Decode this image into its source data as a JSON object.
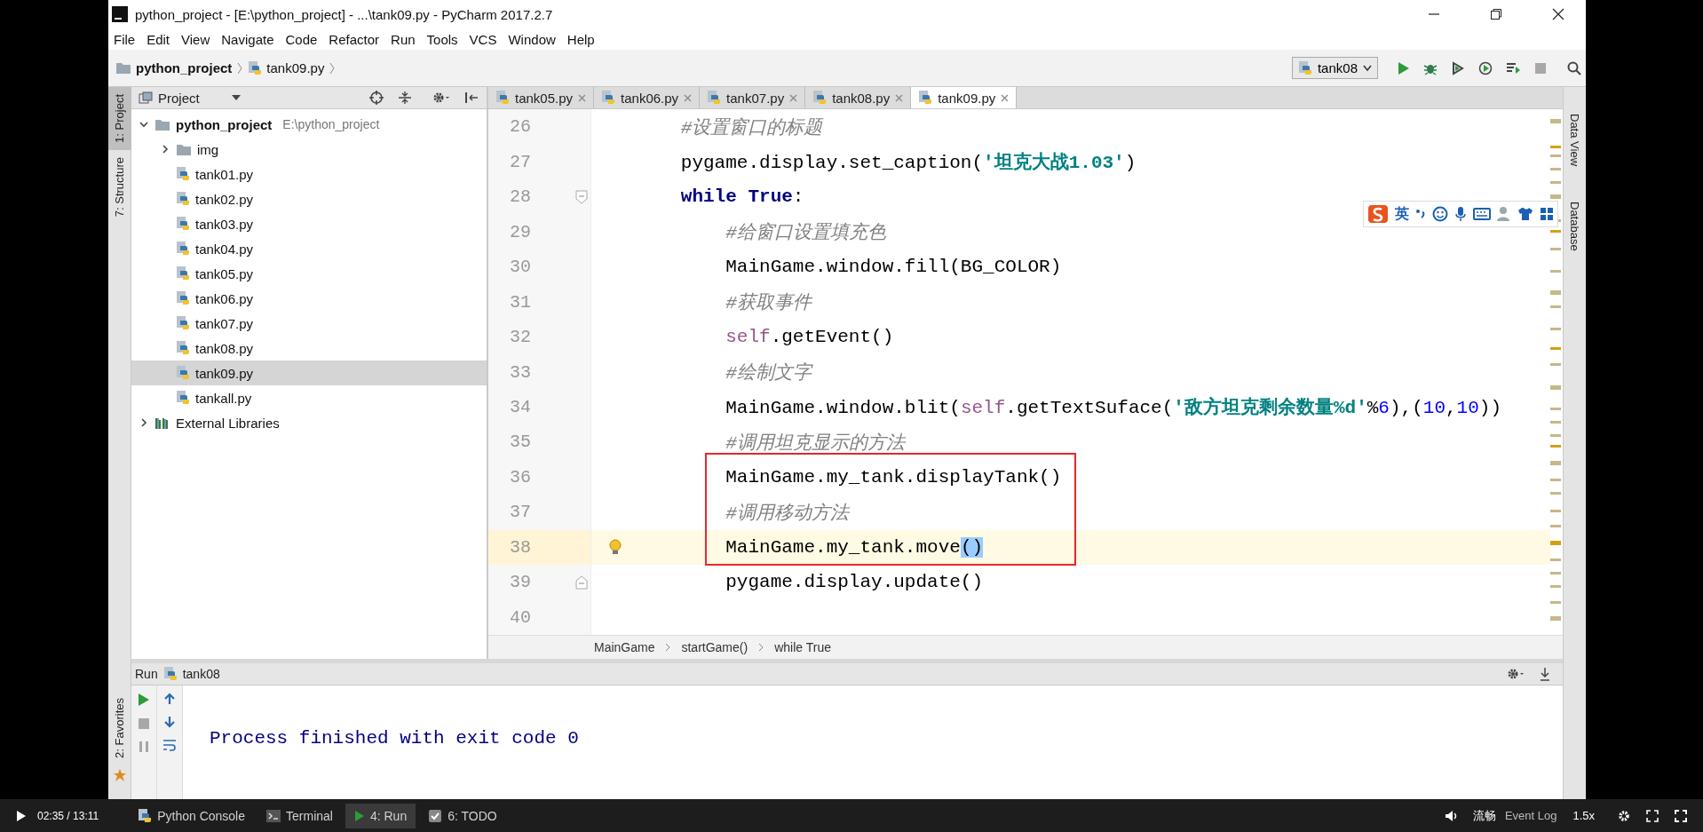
{
  "window": {
    "title": "python_project - [E:\\python_project] - ...\\tank09.py - PyCharm 2017.2.7"
  },
  "menu": [
    "File",
    "Edit",
    "View",
    "Navigate",
    "Code",
    "Refactor",
    "Run",
    "Tools",
    "VCS",
    "Window",
    "Help"
  ],
  "navigation_bar": {
    "breadcrumbs": [
      "python_project",
      "tank09.py"
    ],
    "run_configuration": "tank08"
  },
  "left_tool_tabs": [
    {
      "label": "1: Project",
      "selected": true
    },
    {
      "label": "7: Structure",
      "selected": false
    }
  ],
  "project_panel": {
    "title": "Project",
    "tree": [
      {
        "name": "python_project",
        "path": "E:\\python_project",
        "kind": "project",
        "expanded": true,
        "selected": false,
        "children": [
          {
            "name": "img",
            "kind": "folder",
            "expanded": false,
            "selected": false
          },
          {
            "name": "tank01.py",
            "kind": "python",
            "selected": false
          },
          {
            "name": "tank02.py",
            "kind": "python",
            "selected": false
          },
          {
            "name": "tank03.py",
            "kind": "python",
            "selected": false
          },
          {
            "name": "tank04.py",
            "kind": "python",
            "selected": false
          },
          {
            "name": "tank05.py",
            "kind": "python",
            "selected": false
          },
          {
            "name": "tank06.py",
            "kind": "python",
            "selected": false
          },
          {
            "name": "tank07.py",
            "kind": "python",
            "selected": false
          },
          {
            "name": "tank08.py",
            "kind": "python",
            "selected": false
          },
          {
            "name": "tank09.py",
            "kind": "python",
            "selected": true
          },
          {
            "name": "tankall.py",
            "kind": "python",
            "selected": false
          }
        ]
      },
      {
        "name": "External Libraries",
        "kind": "library",
        "expanded": false,
        "selected": false
      }
    ]
  },
  "editor_tabs": [
    {
      "label": "tank05.py",
      "selected": false
    },
    {
      "label": "tank06.py",
      "selected": false
    },
    {
      "label": "tank07.py",
      "selected": false
    },
    {
      "label": "tank08.py",
      "selected": false
    },
    {
      "label": "tank09.py",
      "selected": true
    }
  ],
  "code_lines": [
    {
      "number": "26",
      "current": false,
      "segments": [
        {
          "kind": "comment",
          "text": "        #设置窗口的标题"
        }
      ]
    },
    {
      "number": "27",
      "current": false,
      "segments": [
        {
          "kind": "plain",
          "text": "        pygame.display.set_caption("
        },
        {
          "kind": "string",
          "text": "'坦克大战1.03'"
        },
        {
          "kind": "plain",
          "text": ")"
        }
      ]
    },
    {
      "number": "28",
      "current": false,
      "fold_start": true,
      "segments": [
        {
          "kind": "keyword",
          "text": "        while True"
        },
        {
          "kind": "plain",
          "text": ":"
        }
      ]
    },
    {
      "number": "29",
      "current": false,
      "segments": [
        {
          "kind": "comment",
          "text": "            #给窗口设置填充色"
        }
      ]
    },
    {
      "number": "30",
      "current": false,
      "segments": [
        {
          "kind": "plain",
          "text": "            MainGame.window.fill(BG_COLOR)"
        }
      ]
    },
    {
      "number": "31",
      "current": false,
      "segments": [
        {
          "kind": "comment",
          "text": "            #获取事件"
        }
      ]
    },
    {
      "number": "32",
      "current": false,
      "segments": [
        {
          "kind": "self",
          "text": "            self"
        },
        {
          "kind": "plain",
          "text": ".getEvent()"
        }
      ]
    },
    {
      "number": "33",
      "current": false,
      "segments": [
        {
          "kind": "comment",
          "text": "            #绘制文字"
        }
      ]
    },
    {
      "number": "34",
      "current": false,
      "segments": [
        {
          "kind": "plain",
          "text": "            MainGame.window.blit("
        },
        {
          "kind": "self",
          "text": "self"
        },
        {
          "kind": "plain",
          "text": ".getTextSuface("
        },
        {
          "kind": "string",
          "text": "'敌方坦克剩余数量%d'"
        },
        {
          "kind": "plain",
          "text": "%"
        },
        {
          "kind": "number",
          "text": "6"
        },
        {
          "kind": "plain",
          "text": "),("
        },
        {
          "kind": "number",
          "text": "10"
        },
        {
          "kind": "plain",
          "text": ","
        },
        {
          "kind": "number",
          "text": "10"
        },
        {
          "kind": "plain",
          "text": "))"
        }
      ]
    },
    {
      "number": "35",
      "current": false,
      "segments": [
        {
          "kind": "comment",
          "text": "            #调用坦克显示的方法"
        }
      ]
    },
    {
      "number": "36",
      "current": false,
      "segments": [
        {
          "kind": "plain",
          "text": "            MainGame.my_tank.displayTank()"
        }
      ]
    },
    {
      "number": "37",
      "current": false,
      "segments": [
        {
          "kind": "comment",
          "text": "            #调用移动方法"
        }
      ]
    },
    {
      "number": "38",
      "current": true,
      "segments": [
        {
          "kind": "plain",
          "text": "            MainGame.my_tank.move"
        },
        {
          "kind": "match",
          "text": "()"
        }
      ]
    },
    {
      "number": "39",
      "current": false,
      "fold_end": true,
      "segments": [
        {
          "kind": "plain",
          "text": "            pygame.display.update()"
        }
      ]
    },
    {
      "number": "40",
      "current": false
    }
  ],
  "breadcrumbs": [
    "MainGame",
    "startGame()",
    "while True"
  ],
  "right_tool_tabs": [
    "Data View",
    "Database"
  ],
  "input_method_toolbar": {
    "mode": "英"
  },
  "run_panel": {
    "title": "Run",
    "configuration": "tank08",
    "output": "Process finished with exit code 0"
  },
  "favorites_tab": "2: Favorites",
  "player": {
    "time": "02:35 / 13:11",
    "quality": "流畅",
    "event_log": "Event Log",
    "speed": "1.5x"
  },
  "bottom_tool_tabs": [
    {
      "label": "Python Console",
      "selected": false
    },
    {
      "label": "Terminal",
      "selected": false
    },
    {
      "label": "4: Run",
      "selected": true
    },
    {
      "label": "6: TODO",
      "selected": false
    }
  ]
}
